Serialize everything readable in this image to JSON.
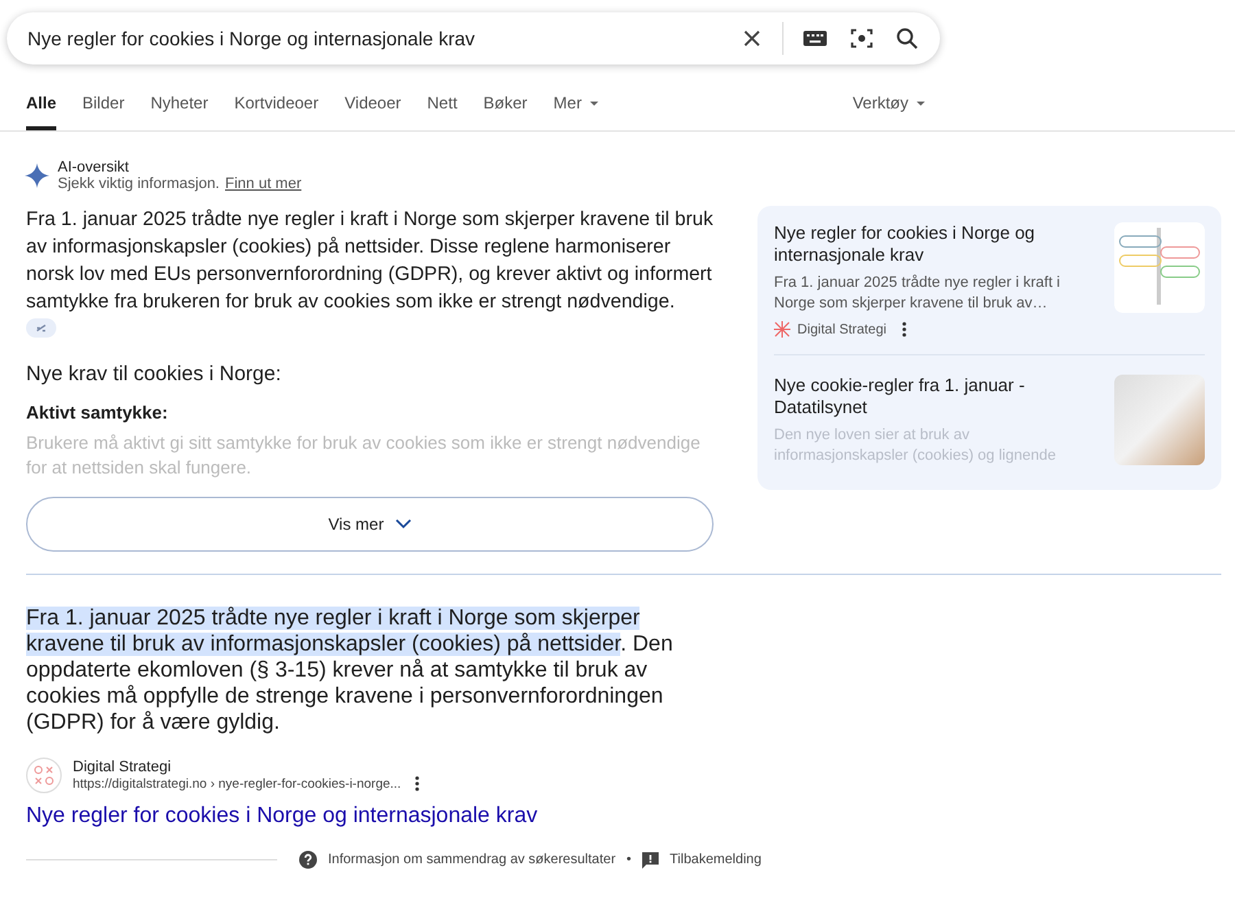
{
  "search": {
    "value": "Nye regler for cookies i Norge og internasjonale krav"
  },
  "tabs": [
    {
      "label": "Alle",
      "selected": true
    },
    {
      "label": "Bilder",
      "selected": false
    },
    {
      "label": "Nyheter",
      "selected": false
    },
    {
      "label": "Kortvideoer",
      "selected": false
    },
    {
      "label": "Videoer",
      "selected": false
    },
    {
      "label": "Nett",
      "selected": false
    },
    {
      "label": "Bøker",
      "selected": false
    },
    {
      "label": "Mer",
      "selected": false,
      "kind": "menu"
    }
  ],
  "tools": {
    "label": "Verktøy"
  },
  "ai_overview": {
    "title": "AI-oversikt",
    "subtitle": "Sjekk viktig informasjon.",
    "link": "Finn ut mer",
    "paragraph": "Fra 1. januar 2025 trådte nye regler i kraft i Norge som skjerper kravene til bruk av informasjonskapsler (cookies) på nettsider. Disse reglene harmoniserer norsk lov med EUs personvernforordning (GDPR), og krever aktivt og informert samtykke fra brukeren for bruk av cookies som ikke er strengt nødvendige.",
    "heading": "Nye krav til cookies i Norge:",
    "subheading": "Aktivt samtykke:",
    "faded_text": "Brukere må aktivt gi sitt samtykke for bruk av cookies som ikke er strengt nødvendige for at nettsiden skal fungere.",
    "button": "Vis mer",
    "sources": [
      {
        "title": "Nye regler for cookies i Norge og internasjonale krav",
        "snippet": "Fra 1. januar 2025 trådte nye regler i kraft i Norge som skjerper kravene til bruk av…",
        "site": "Digital Strategi",
        "kind": "diagram"
      },
      {
        "title": "Nye cookie-regler fra 1. januar - Datatilsynet",
        "snippet": "Den nye loven sier at bruk av informasjonskapsler (cookies) og lignende",
        "kind": "photo"
      }
    ]
  },
  "featured": {
    "highlight": "Fra 1.  januar 2025 trådte nye regler i kraft i Norge som skjerper kravene til bruk av informasjonskapsler (cookies) på nettsider",
    "rest": ". Den oppdaterte ekomloven (§ 3-15) krever nå at samtykke til bruk av cookies må oppfylle de strenge kravene i personvernforordningen (GDPR) for å være gyldig.",
    "site": "Digital Strategi",
    "url": "https://digitalstrategi.no › nye-regler-for-cookies-i-norge...",
    "link": "Nye regler for cookies i Norge og internasjonale krav"
  },
  "footer": {
    "info": "Informasjon om sammendrag av søkeresultater",
    "separator": "•",
    "feedback": "Tilbakemelding"
  }
}
